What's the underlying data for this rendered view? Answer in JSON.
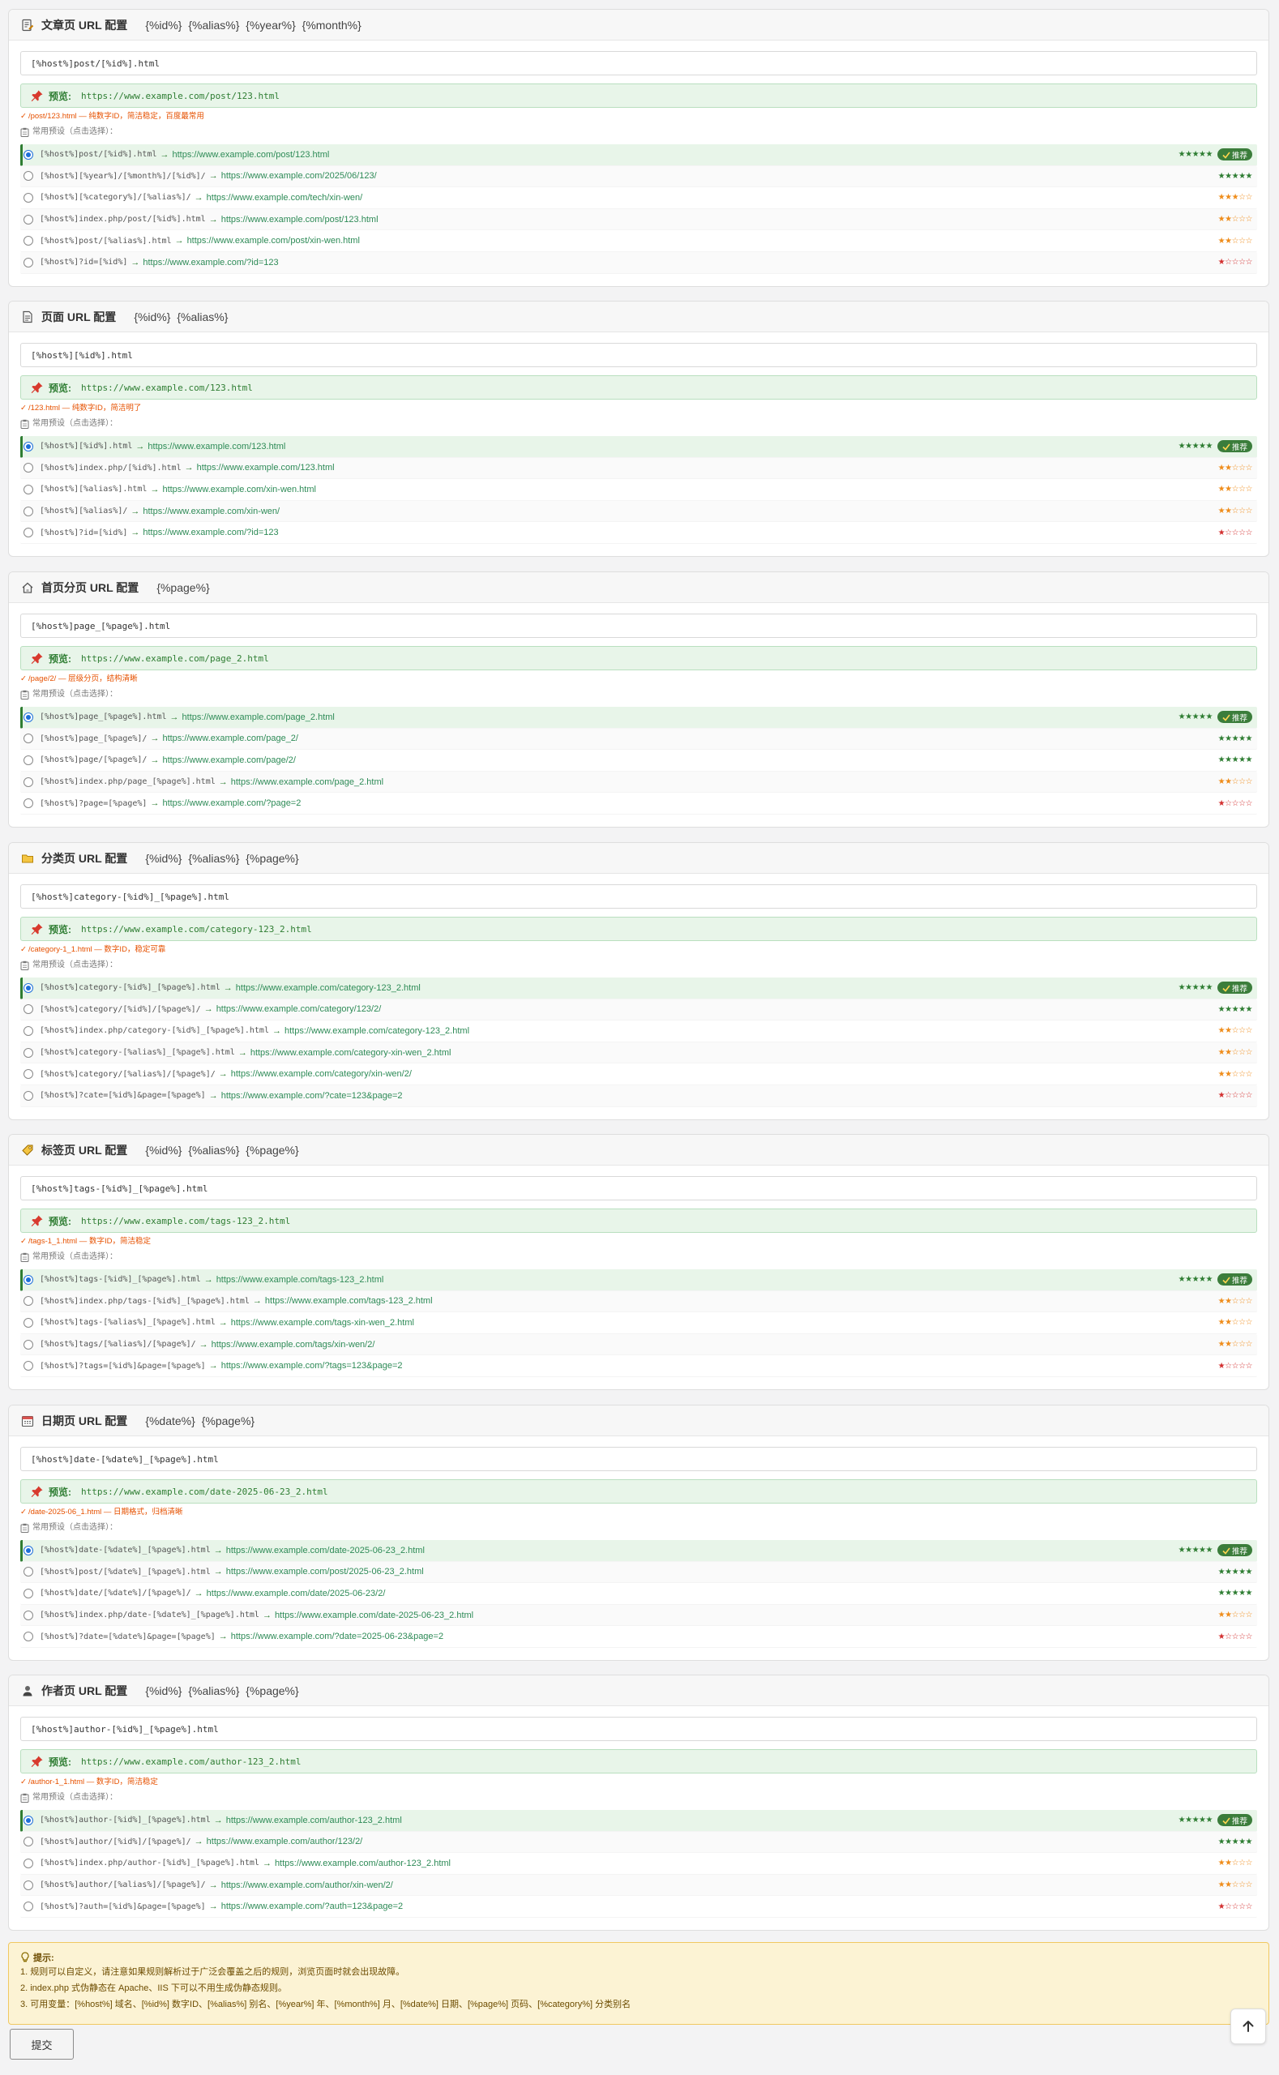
{
  "arrow": "→",
  "preview_label": "预览:",
  "preset_label": "常用预设（点击选择）：",
  "recommend_badge": "推荐",
  "sections": [
    {
      "title": "文章页 URL 配置",
      "vars": "{%id%} {%alias%} {%year%} {%month%}",
      "icon": "document-pencil-icon",
      "input_value": "[%host%]post/[%id%].html",
      "preview_url": "https://www.example.com/post/123.html",
      "tip": "/post/123.html — 纯数字ID，简洁稳定，百度最常用",
      "options": [
        {
          "pattern": "[%host%]post/[%id%].html",
          "url": "https://www.example.com/post/123.html",
          "stars": "★★★★★",
          "level": 5,
          "selected": true
        },
        {
          "pattern": "[%host%][%year%]/[%month%]/[%id%]/",
          "url": "https://www.example.com/2025/06/123/",
          "stars": "★★★★★",
          "level": 5
        },
        {
          "pattern": "[%host%][%category%]/[%alias%]/",
          "url": "https://www.example.com/tech/xin-wen/",
          "stars": "★★★☆☆",
          "level": 3
        },
        {
          "pattern": "[%host%]index.php/post/[%id%].html",
          "url": "https://www.example.com/post/123.html",
          "stars": "★★☆☆☆",
          "level": 2
        },
        {
          "pattern": "[%host%]post/[%alias%].html",
          "url": "https://www.example.com/post/xin-wen.html",
          "stars": "★★☆☆☆",
          "level": 2
        },
        {
          "pattern": "[%host%]?id=[%id%]",
          "url": "https://www.example.com/?id=123",
          "stars": "★☆☆☆☆",
          "level": 1
        }
      ]
    },
    {
      "title": "页面 URL 配置",
      "vars": "{%id%} {%alias%}",
      "icon": "page-icon",
      "input_value": "[%host%][%id%].html",
      "preview_url": "https://www.example.com/123.html",
      "tip": "/123.html — 纯数字ID，简洁明了",
      "options": [
        {
          "pattern": "[%host%][%id%].html",
          "url": "https://www.example.com/123.html",
          "stars": "★★★★★",
          "level": 5,
          "selected": true
        },
        {
          "pattern": "[%host%]index.php/[%id%].html",
          "url": "https://www.example.com/123.html",
          "stars": "★★☆☆☆",
          "level": 2
        },
        {
          "pattern": "[%host%][%alias%].html",
          "url": "https://www.example.com/xin-wen.html",
          "stars": "★★☆☆☆",
          "level": 2
        },
        {
          "pattern": "[%host%][%alias%]/",
          "url": "https://www.example.com/xin-wen/",
          "stars": "★★☆☆☆",
          "level": 2
        },
        {
          "pattern": "[%host%]?id=[%id%]",
          "url": "https://www.example.com/?id=123",
          "stars": "★☆☆☆☆",
          "level": 1
        }
      ]
    },
    {
      "title": "首页分页 URL 配置",
      "vars": "{%page%}",
      "icon": "home-icon",
      "input_value": "[%host%]page_[%page%].html",
      "preview_url": "https://www.example.com/page_2.html",
      "tip": "/page/2/ — 层级分页，结构清晰",
      "options": [
        {
          "pattern": "[%host%]page_[%page%].html",
          "url": "https://www.example.com/page_2.html",
          "stars": "★★★★★",
          "level": 5,
          "selected": true
        },
        {
          "pattern": "[%host%]page_[%page%]/",
          "url": "https://www.example.com/page_2/",
          "stars": "★★★★★",
          "level": 5
        },
        {
          "pattern": "[%host%]page/[%page%]/",
          "url": "https://www.example.com/page/2/",
          "stars": "★★★★★",
          "level": 5
        },
        {
          "pattern": "[%host%]index.php/page_[%page%].html",
          "url": "https://www.example.com/page_2.html",
          "stars": "★★☆☆☆",
          "level": 2
        },
        {
          "pattern": "[%host%]?page=[%page%]",
          "url": "https://www.example.com/?page=2",
          "stars": "★☆☆☆☆",
          "level": 1
        }
      ]
    },
    {
      "title": "分类页 URL 配置",
      "vars": "{%id%} {%alias%} {%page%}",
      "icon": "folder-icon",
      "input_value": "[%host%]category-[%id%]_[%page%].html",
      "preview_url": "https://www.example.com/category-123_2.html",
      "tip": "/category-1_1.html — 数字ID，稳定可靠",
      "options": [
        {
          "pattern": "[%host%]category-[%id%]_[%page%].html",
          "url": "https://www.example.com/category-123_2.html",
          "stars": "★★★★★",
          "level": 5,
          "selected": true
        },
        {
          "pattern": "[%host%]category/[%id%]/[%page%]/",
          "url": "https://www.example.com/category/123/2/",
          "stars": "★★★★★",
          "level": 5
        },
        {
          "pattern": "[%host%]index.php/category-[%id%]_[%page%].html",
          "url": "https://www.example.com/category-123_2.html",
          "stars": "★★☆☆☆",
          "level": 2
        },
        {
          "pattern": "[%host%]category-[%alias%]_[%page%].html",
          "url": "https://www.example.com/category-xin-wen_2.html",
          "stars": "★★☆☆☆",
          "level": 2
        },
        {
          "pattern": "[%host%]category/[%alias%]/[%page%]/",
          "url": "https://www.example.com/category/xin-wen/2/",
          "stars": "★★☆☆☆",
          "level": 2
        },
        {
          "pattern": "[%host%]?cate=[%id%]&page=[%page%]",
          "url": "https://www.example.com/?cate=123&page=2",
          "stars": "★☆☆☆☆",
          "level": 1
        }
      ]
    },
    {
      "title": "标签页 URL 配置",
      "vars": "{%id%} {%alias%} {%page%}",
      "icon": "tag-icon",
      "input_value": "[%host%]tags-[%id%]_[%page%].html",
      "preview_url": "https://www.example.com/tags-123_2.html",
      "tip": "/tags-1_1.html — 数字ID，简洁稳定",
      "options": [
        {
          "pattern": "[%host%]tags-[%id%]_[%page%].html",
          "url": "https://www.example.com/tags-123_2.html",
          "stars": "★★★★★",
          "level": 5,
          "selected": true
        },
        {
          "pattern": "[%host%]index.php/tags-[%id%]_[%page%].html",
          "url": "https://www.example.com/tags-123_2.html",
          "stars": "★★☆☆☆",
          "level": 2
        },
        {
          "pattern": "[%host%]tags-[%alias%]_[%page%].html",
          "url": "https://www.example.com/tags-xin-wen_2.html",
          "stars": "★★☆☆☆",
          "level": 2
        },
        {
          "pattern": "[%host%]tags/[%alias%]/[%page%]/",
          "url": "https://www.example.com/tags/xin-wen/2/",
          "stars": "★★☆☆☆",
          "level": 2
        },
        {
          "pattern": "[%host%]?tags=[%id%]&page=[%page%]",
          "url": "https://www.example.com/?tags=123&page=2",
          "stars": "★☆☆☆☆",
          "level": 1
        }
      ]
    },
    {
      "title": "日期页 URL 配置",
      "vars": "{%date%} {%page%}",
      "icon": "calendar-icon",
      "input_value": "[%host%]date-[%date%]_[%page%].html",
      "preview_url": "https://www.example.com/date-2025-06-23_2.html",
      "tip": "/date-2025-06_1.html — 日期格式，归档清晰",
      "options": [
        {
          "pattern": "[%host%]date-[%date%]_[%page%].html",
          "url": "https://www.example.com/date-2025-06-23_2.html",
          "stars": "★★★★★",
          "level": 5,
          "selected": true
        },
        {
          "pattern": "[%host%]post/[%date%]_[%page%].html",
          "url": "https://www.example.com/post/2025-06-23_2.html",
          "stars": "★★★★★",
          "level": 5
        },
        {
          "pattern": "[%host%]date/[%date%]/[%page%]/",
          "url": "https://www.example.com/date/2025-06-23/2/",
          "stars": "★★★★★",
          "level": 5
        },
        {
          "pattern": "[%host%]index.php/date-[%date%]_[%page%].html",
          "url": "https://www.example.com/date-2025-06-23_2.html",
          "stars": "★★☆☆☆",
          "level": 2
        },
        {
          "pattern": "[%host%]?date=[%date%]&page=[%page%]",
          "url": "https://www.example.com/?date=2025-06-23&page=2",
          "stars": "★☆☆☆☆",
          "level": 1
        }
      ]
    },
    {
      "title": "作者页 URL 配置",
      "vars": "{%id%} {%alias%} {%page%}",
      "icon": "user-icon",
      "input_value": "[%host%]author-[%id%]_[%page%].html",
      "preview_url": "https://www.example.com/author-123_2.html",
      "tip": "/author-1_1.html — 数字ID，简洁稳定",
      "options": [
        {
          "pattern": "[%host%]author-[%id%]_[%page%].html",
          "url": "https://www.example.com/author-123_2.html",
          "stars": "★★★★★",
          "level": 5,
          "selected": true
        },
        {
          "pattern": "[%host%]author/[%id%]/[%page%]/",
          "url": "https://www.example.com/author/123/2/",
          "stars": "★★★★★",
          "level": 5
        },
        {
          "pattern": "[%host%]index.php/author-[%id%]_[%page%].html",
          "url": "https://www.example.com/author-123_2.html",
          "stars": "★★☆☆☆",
          "level": 2
        },
        {
          "pattern": "[%host%]author/[%alias%]/[%page%]/",
          "url": "https://www.example.com/author/xin-wen/2/",
          "stars": "★★☆☆☆",
          "level": 2
        },
        {
          "pattern": "[%host%]?auth=[%id%]&page=[%page%]",
          "url": "https://www.example.com/?auth=123&page=2",
          "stars": "★☆☆☆☆",
          "level": 1
        }
      ]
    }
  ],
  "notice": {
    "title": "提示:",
    "line1": "1. 规则可以自定义，请注意如果规则解析过于广泛会覆盖之后的规则，浏览页面时就会出现故障。",
    "line2": "2. index.php 式伪静态在 Apache、IIS 下可以不用生成伪静态规则。",
    "line3": "3. 可用变量：[%host%] 域名、[%id%] 数字ID、[%alias%] 别名、[%year%] 年、[%month%] 月、[%date%] 日期、[%page%] 页码、[%category%] 分类别名"
  },
  "submit_label": "提交"
}
